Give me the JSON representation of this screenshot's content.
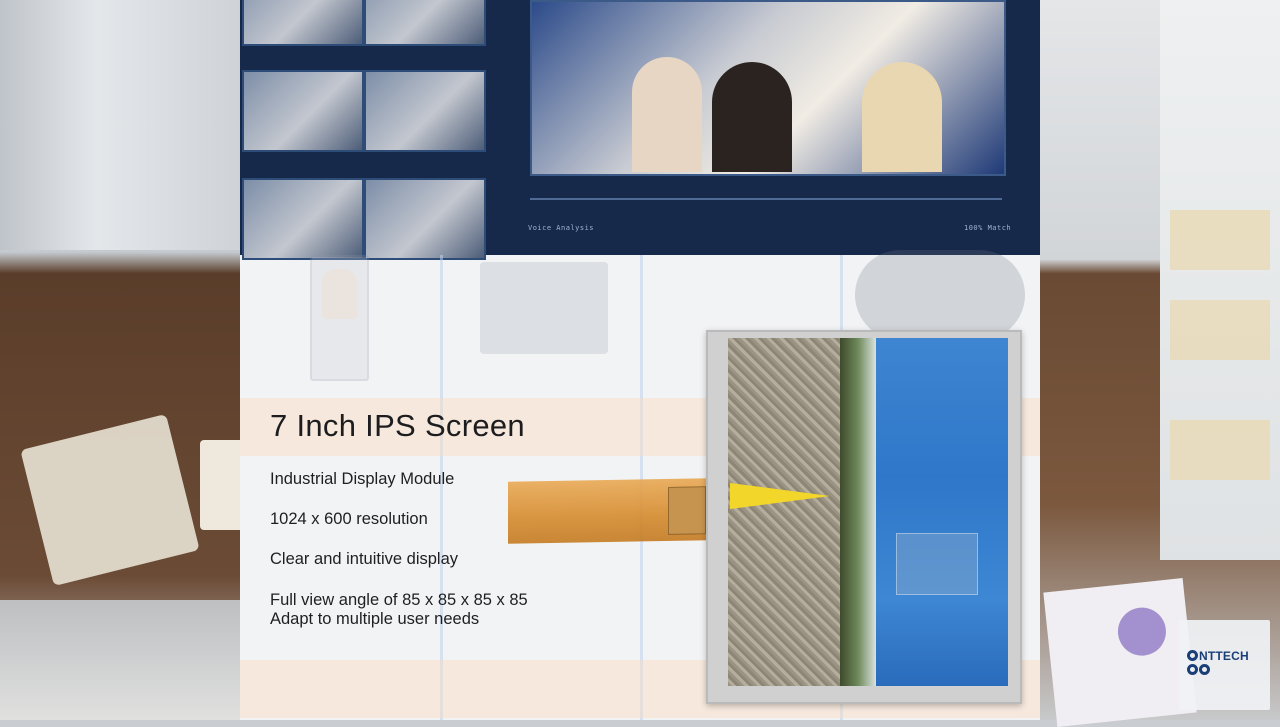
{
  "product": {
    "title": "7 Inch IPS Screen",
    "features": [
      "Industrial Display Module",
      "1024 x 600 resolution",
      "Clear and intuitive display",
      "Full view angle of 85 x 85 x 85 x 85\nAdapt to multiple user needs"
    ]
  },
  "dashboard_bg": {
    "caption_left": "Voice Analysis",
    "caption_right": "100% Match"
  },
  "watermark": {
    "brand": "NTTECH"
  },
  "colors": {
    "dashboard": "#16294a",
    "arrow": "#f3d62a",
    "cable": "#d58a2c",
    "logo": "#1a3f78"
  }
}
